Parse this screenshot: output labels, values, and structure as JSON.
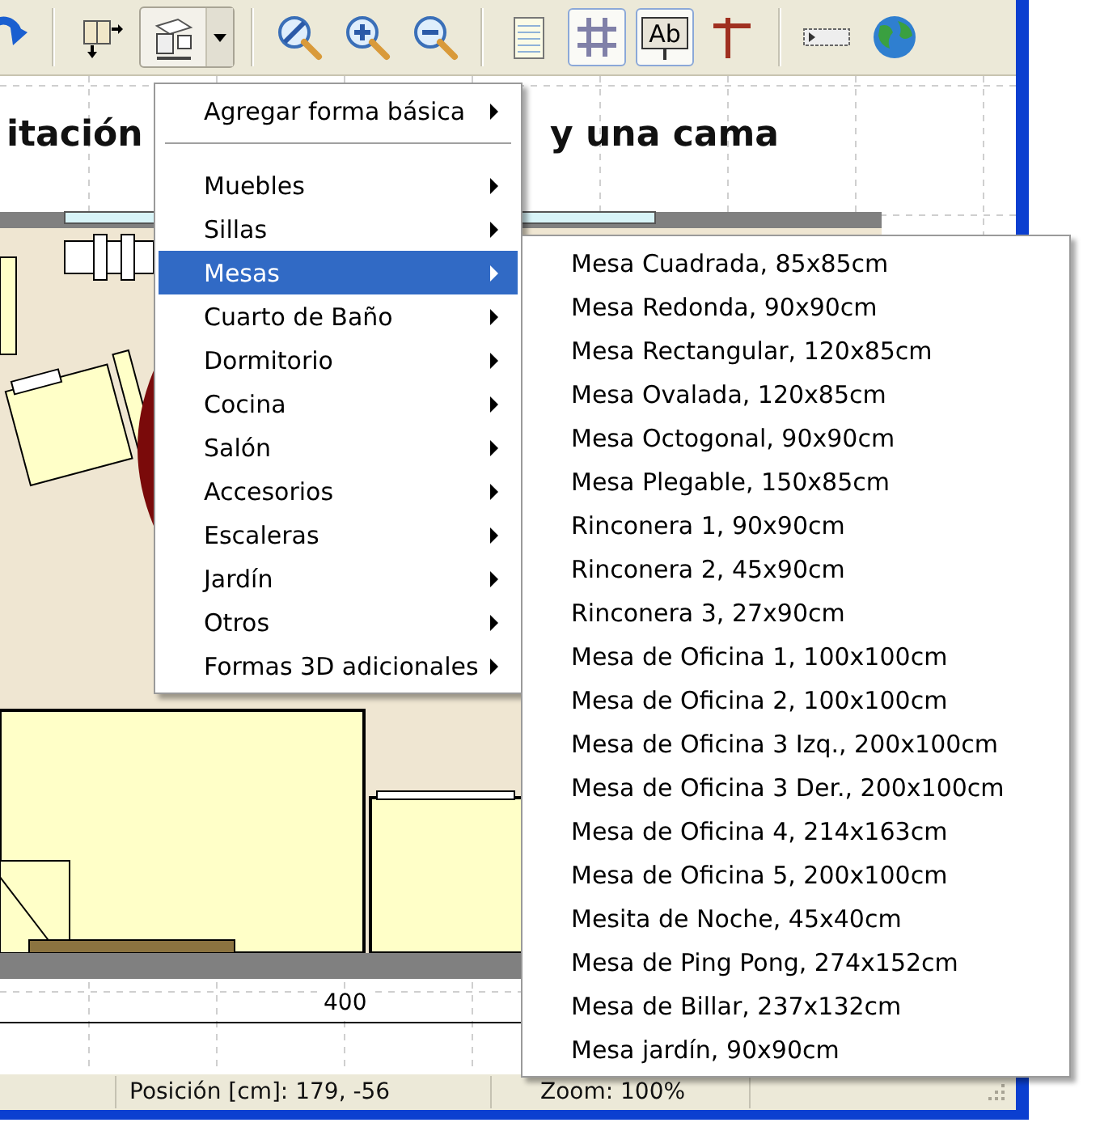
{
  "toolbar": {
    "shapes_dropdown": {
      "open": true
    },
    "grid_toggle": {
      "on": true
    },
    "label_toggle": {
      "on": true,
      "glyph": "Ab"
    }
  },
  "canvas": {
    "title_left": "itación",
    "title_right": "y una cama",
    "dimension": "400"
  },
  "menu": {
    "items": [
      {
        "kind": "item",
        "label": "Agregar forma básica",
        "has_submenu": true,
        "selected": false
      },
      {
        "kind": "separator"
      },
      {
        "kind": "item",
        "label": "Muebles",
        "has_submenu": true,
        "selected": false
      },
      {
        "kind": "item",
        "label": "Sillas",
        "has_submenu": true,
        "selected": false
      },
      {
        "kind": "item",
        "label": "Mesas",
        "has_submenu": true,
        "selected": true
      },
      {
        "kind": "item",
        "label": "Cuarto de Baño",
        "has_submenu": true,
        "selected": false
      },
      {
        "kind": "item",
        "label": "Dormitorio",
        "has_submenu": true,
        "selected": false
      },
      {
        "kind": "item",
        "label": "Cocina",
        "has_submenu": true,
        "selected": false
      },
      {
        "kind": "item",
        "label": "Salón",
        "has_submenu": true,
        "selected": false
      },
      {
        "kind": "item",
        "label": "Accesorios",
        "has_submenu": true,
        "selected": false
      },
      {
        "kind": "item",
        "label": "Escaleras",
        "has_submenu": true,
        "selected": false
      },
      {
        "kind": "item",
        "label": "Jardín",
        "has_submenu": true,
        "selected": false
      },
      {
        "kind": "item",
        "label": "Otros",
        "has_submenu": true,
        "selected": false
      },
      {
        "kind": "item",
        "label": "Formas 3D adicionales",
        "has_submenu": true,
        "selected": false
      }
    ]
  },
  "submenu": {
    "items": [
      {
        "label": "Mesa Cuadrada, 85x85cm",
        "selected": false
      },
      {
        "label": "Mesa Redonda, 90x90cm",
        "selected": false
      },
      {
        "label": "Mesa Rectangular, 120x85cm",
        "selected": false
      },
      {
        "label": "Mesa Ovalada, 120x85cm",
        "selected": false
      },
      {
        "label": "Mesa Octogonal, 90x90cm",
        "selected": false
      },
      {
        "label": "Mesa Plegable, 150x85cm",
        "selected": false
      },
      {
        "label": "Rinconera 1, 90x90cm",
        "selected": false
      },
      {
        "label": "Rinconera 2, 45x90cm",
        "selected": false
      },
      {
        "label": "Rinconera 3, 27x90cm",
        "selected": false
      },
      {
        "label": "Mesa de Oficina 1, 100x100cm",
        "selected": false
      },
      {
        "label": "Mesa de Oficina 2, 100x100cm",
        "selected": false
      },
      {
        "label": "Mesa de Oficina 3 Izq., 200x100cm",
        "selected": false
      },
      {
        "label": "Mesa de Oficina 3 Der., 200x100cm",
        "selected": false
      },
      {
        "label": "Mesa de Oficina 4, 214x163cm",
        "selected": false
      },
      {
        "label": "Mesa de Oficina 5, 200x100cm",
        "selected": false
      },
      {
        "label": "Mesita de Noche, 45x40cm",
        "selected": false
      },
      {
        "label": "Mesa de Ping Pong, 274x152cm",
        "selected": false
      },
      {
        "label": "Mesa de Billar, 237x132cm",
        "selected": false
      },
      {
        "label": "Mesa jardín, 90x90cm",
        "selected": false
      }
    ]
  },
  "status_bar": {
    "position": "Posición [cm]: 179, -56",
    "zoom": "Zoom: 100%"
  }
}
